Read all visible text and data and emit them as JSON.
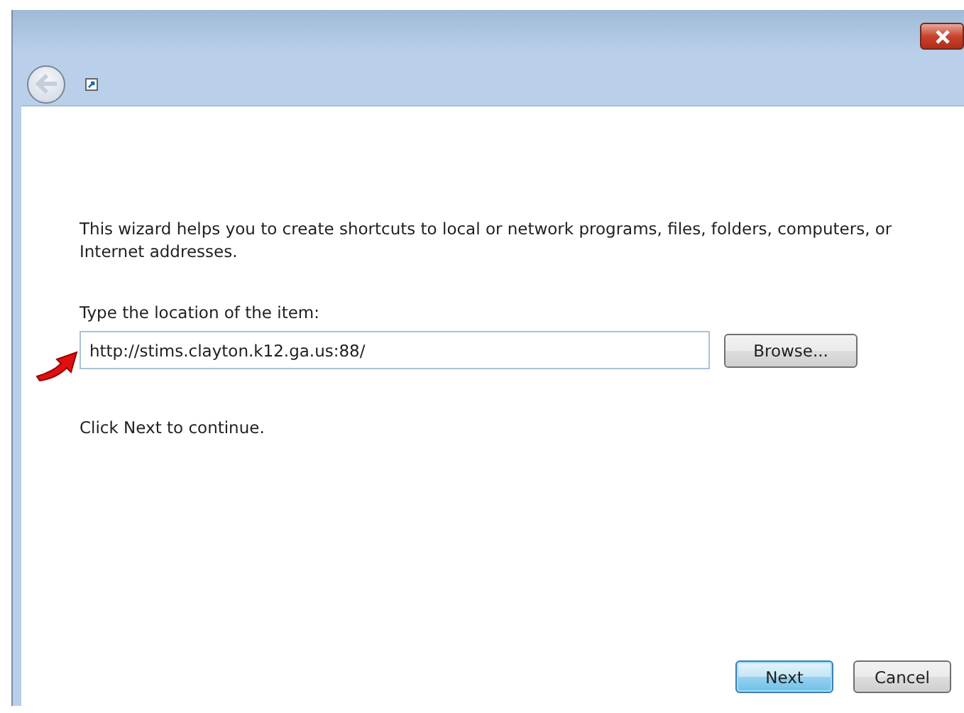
{
  "intro": "This wizard helps you to create shortcuts to local or network programs, files, folders, computers, or Internet addresses.",
  "location": {
    "label": "Type the location of the item:",
    "value": "http://stims.clayton.k12.ga.us:88/",
    "browse": "Browse..."
  },
  "hint": "Click Next to continue.",
  "buttons": [
    {
      "label": "Next",
      "default": true
    },
    {
      "label": "Cancel",
      "default": false
    }
  ]
}
